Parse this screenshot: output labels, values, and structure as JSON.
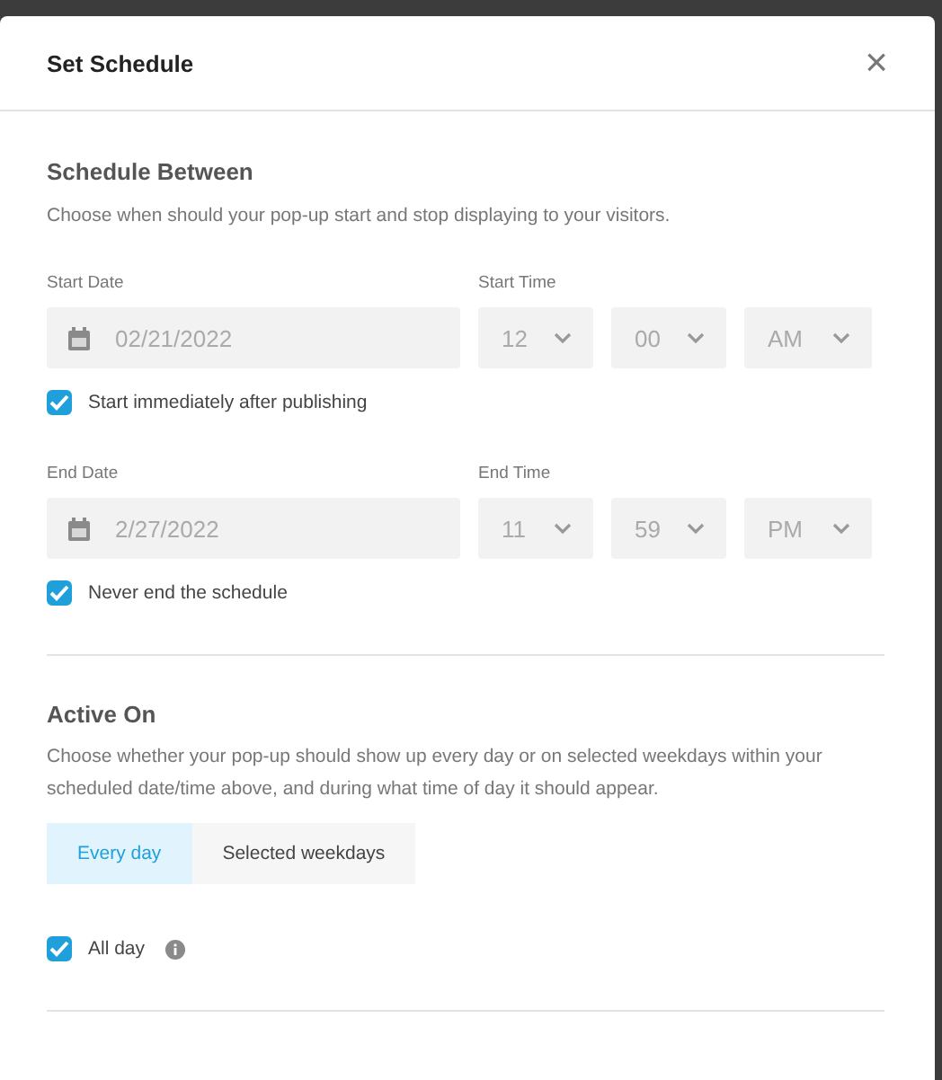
{
  "dialog": {
    "title": "Set Schedule",
    "close": "×"
  },
  "schedule": {
    "heading": "Schedule Between",
    "description": "Choose when should your pop-up start and stop displaying to your visitors.",
    "groups": [
      {
        "date_label": "Start Date",
        "date": "02/21/2022",
        "time_label": "Start Time",
        "time": [
          "12",
          "00",
          "AM"
        ],
        "checkbox": {
          "label": "Start immediately after publishing",
          "checked": true
        }
      },
      {
        "date_label": "End Date",
        "date": "2/27/2022",
        "time_label": "End Time",
        "time": [
          "11",
          "59",
          "PM"
        ],
        "checkbox": {
          "label": "Never end the schedule",
          "checked": true
        }
      }
    ]
  },
  "active_on": {
    "heading": "Active On",
    "description": "Choose whether your pop-up should show up every day or on selected weekdays within your scheduled date/time above, and during what time of day it should appear.",
    "tabs": [
      {
        "label": "Every day",
        "selected": true
      },
      {
        "label": "Selected weekdays",
        "selected": false
      }
    ],
    "all_day": {
      "label": "All day",
      "checked": true
    }
  }
}
